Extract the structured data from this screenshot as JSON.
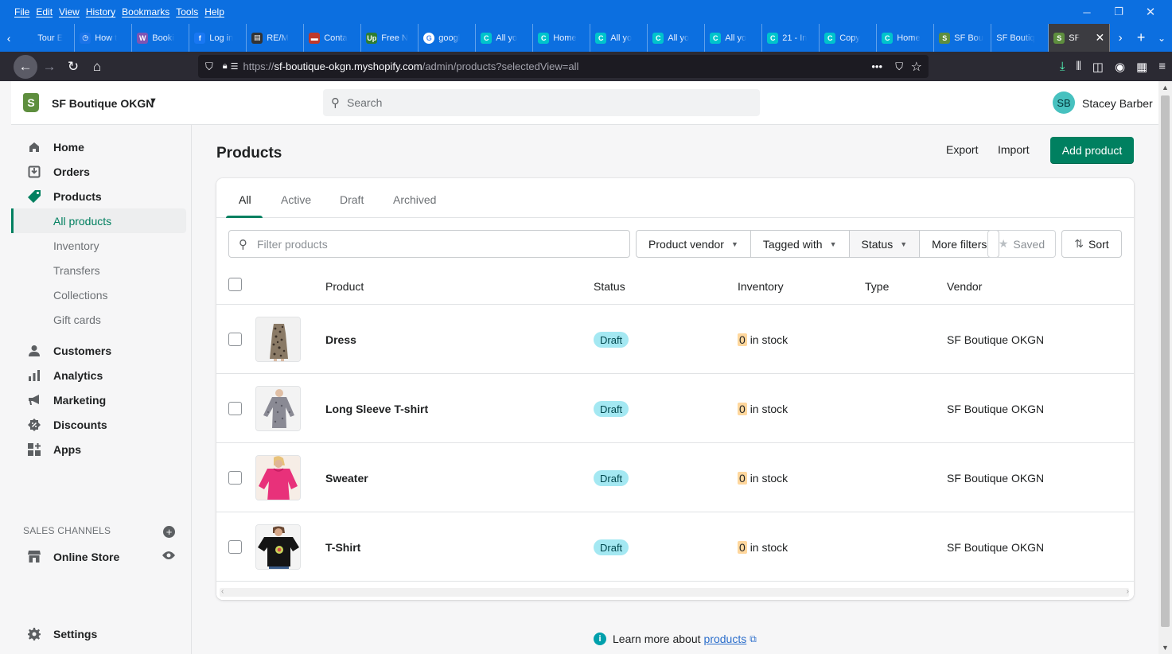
{
  "browser": {
    "menu": [
      "File",
      "Edit",
      "View",
      "History",
      "Bookmarks",
      "Tools",
      "Help"
    ],
    "tabs": [
      {
        "label": "Tour E",
        "icon_color": "#0c6fe0",
        "glyph": ""
      },
      {
        "label": "How t",
        "icon_color": "#1a73e8",
        "glyph": "◷"
      },
      {
        "label": "Booki",
        "icon_color": "#7f54b3",
        "glyph": "W"
      },
      {
        "label": "Log in",
        "icon_color": "#1877f2",
        "glyph": "f"
      },
      {
        "label": "RE/M",
        "icon_color": "#333333",
        "glyph": "▤"
      },
      {
        "label": "Conta",
        "icon_color": "#c0392b",
        "glyph": "▬"
      },
      {
        "label": "Free N",
        "icon_color": "#2e7d32",
        "glyph": "Up"
      },
      {
        "label": "googl",
        "icon_color": "#ffffff",
        "glyph": "G"
      },
      {
        "label": "All yo",
        "icon_color": "#00c4cc",
        "glyph": "C"
      },
      {
        "label": "Home",
        "icon_color": "#00c4cc",
        "glyph": "C"
      },
      {
        "label": "All yo",
        "icon_color": "#00c4cc",
        "glyph": "C"
      },
      {
        "label": "All yo",
        "icon_color": "#00c4cc",
        "glyph": "C"
      },
      {
        "label": "All yo",
        "icon_color": "#00c4cc",
        "glyph": "C"
      },
      {
        "label": "21 - In",
        "icon_color": "#00c4cc",
        "glyph": "C"
      },
      {
        "label": "Copy",
        "icon_color": "#00c4cc",
        "glyph": "C"
      },
      {
        "label": "Home",
        "icon_color": "#00c4cc",
        "glyph": "C"
      },
      {
        "label": "SF Bou",
        "icon_color": "#5e8e3e",
        "glyph": "S"
      },
      {
        "label": "SF Boutiq",
        "icon_color": "",
        "glyph": ""
      }
    ],
    "active_tab": {
      "label": "SF",
      "icon_color": "#5e8e3e",
      "glyph": "S"
    },
    "url_prefix": "https://",
    "url_host": "sf-boutique-okgn.myshopify.com",
    "url_path": "/admin/products?selectedView=all"
  },
  "topbar": {
    "store_name": "SF Boutique OKGN",
    "search_placeholder": "Search",
    "user_initials": "SB",
    "user_name": "Stacey Barber"
  },
  "sidebar": {
    "items": [
      {
        "label": "Home",
        "icon": "home-icon"
      },
      {
        "label": "Orders",
        "icon": "orders-icon"
      },
      {
        "label": "Products",
        "icon": "tag-icon"
      }
    ],
    "sub_items": [
      "All products",
      "Inventory",
      "Transfers",
      "Collections",
      "Gift cards"
    ],
    "items2": [
      {
        "label": "Customers",
        "icon": "person-icon"
      },
      {
        "label": "Analytics",
        "icon": "bar-chart-icon"
      },
      {
        "label": "Marketing",
        "icon": "megaphone-icon"
      },
      {
        "label": "Discounts",
        "icon": "discount-icon"
      },
      {
        "label": "Apps",
        "icon": "apps-icon"
      }
    ],
    "sales_channels_heading": "SALES CHANNELS",
    "online_store": "Online Store",
    "settings": "Settings"
  },
  "page": {
    "title": "Products",
    "export": "Export",
    "import": "Import",
    "add_product": "Add product"
  },
  "tabs": [
    "All",
    "Active",
    "Draft",
    "Archived"
  ],
  "filters": {
    "placeholder": "Filter products",
    "product_vendor": "Product vendor",
    "tagged_with": "Tagged with",
    "status": "Status",
    "more_filters": "More filters",
    "saved": "Saved",
    "sort": "Sort"
  },
  "table": {
    "columns": [
      "Product",
      "Status",
      "Inventory",
      "Type",
      "Vendor"
    ],
    "rows": [
      {
        "name": "Dress",
        "status": "Draft",
        "inv_count": "0",
        "inv_label": "in stock",
        "type": "",
        "vendor": "SF Boutique OKGN"
      },
      {
        "name": "Long Sleeve T-shirt",
        "status": "Draft",
        "inv_count": "0",
        "inv_label": "in stock",
        "type": "",
        "vendor": "SF Boutique OKGN"
      },
      {
        "name": "Sweater",
        "status": "Draft",
        "inv_count": "0",
        "inv_label": "in stock",
        "type": "",
        "vendor": "SF Boutique OKGN"
      },
      {
        "name": "T-Shirt",
        "status": "Draft",
        "inv_count": "0",
        "inv_label": "in stock",
        "type": "",
        "vendor": "SF Boutique OKGN"
      }
    ]
  },
  "footer": {
    "learn_text": "Learn more about",
    "learn_link": "products"
  },
  "colors": {
    "accent": "#008060",
    "browser_blue": "#0c6fe0",
    "draft_badge": "#a4e8f2",
    "inventory_zero": "#ffd79d"
  }
}
